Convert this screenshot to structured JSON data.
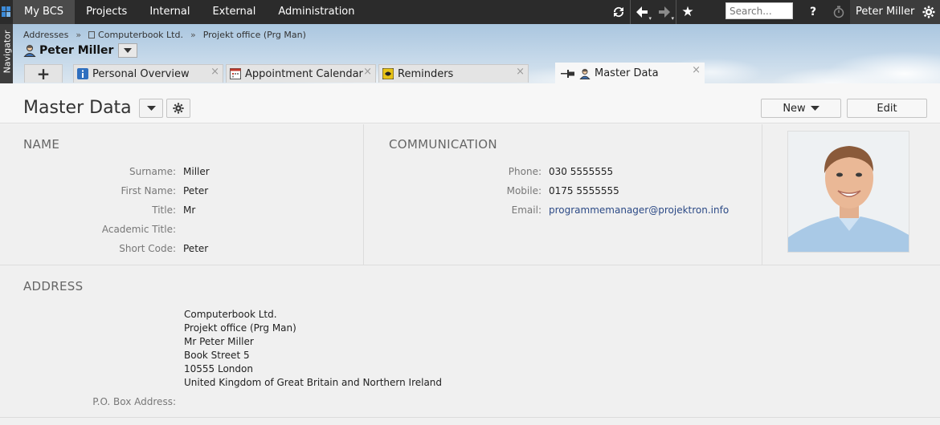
{
  "topnav": {
    "items": [
      "My BCS",
      "Projects",
      "Internal",
      "External",
      "Administration"
    ],
    "search_placeholder": "Search...",
    "help_label": "?",
    "user_name": "Peter Miller"
  },
  "navigator": {
    "label": "Navigator"
  },
  "breadcrumb": [
    "Addresses",
    "Computerbook Ltd.",
    "Projekt office (Prg Man)"
  ],
  "person": {
    "name": "Peter Miller"
  },
  "tabs": [
    {
      "label": "Personal Overview"
    },
    {
      "label": "Appointment Calendar"
    },
    {
      "label": "Reminders"
    },
    {
      "label": "Master Data"
    }
  ],
  "page": {
    "title": "Master Data",
    "new_label": "New",
    "edit_label": "Edit"
  },
  "name_section": {
    "heading": "NAME",
    "fields": [
      {
        "label": "Surname:",
        "value": "Miller"
      },
      {
        "label": "First Name:",
        "value": "Peter"
      },
      {
        "label": "Title:",
        "value": "Mr"
      },
      {
        "label": "Academic Title:",
        "value": ""
      },
      {
        "label": "Short Code:",
        "value": "Peter"
      }
    ]
  },
  "communication_section": {
    "heading": "COMMUNICATION",
    "fields": [
      {
        "label": "Phone:",
        "value": "030 5555555"
      },
      {
        "label": "Mobile:",
        "value": "0175 5555555"
      },
      {
        "label": "Email:",
        "value": "programmemanager@projektron.info"
      }
    ]
  },
  "address_section": {
    "heading": "ADDRESS",
    "lines": [
      "Computerbook Ltd.",
      "Projekt office (Prg Man)",
      "Mr Peter Miller",
      "Book Street 5",
      "10555 London",
      "United Kingdom of Great Britain and Northern Ireland"
    ],
    "po_box_label": "P.O. Box Address:",
    "po_box_value": ""
  },
  "colors": {
    "topbar": "#2b2b2b",
    "link": "#2c4a86",
    "section_bg": "#f0f0f0"
  }
}
